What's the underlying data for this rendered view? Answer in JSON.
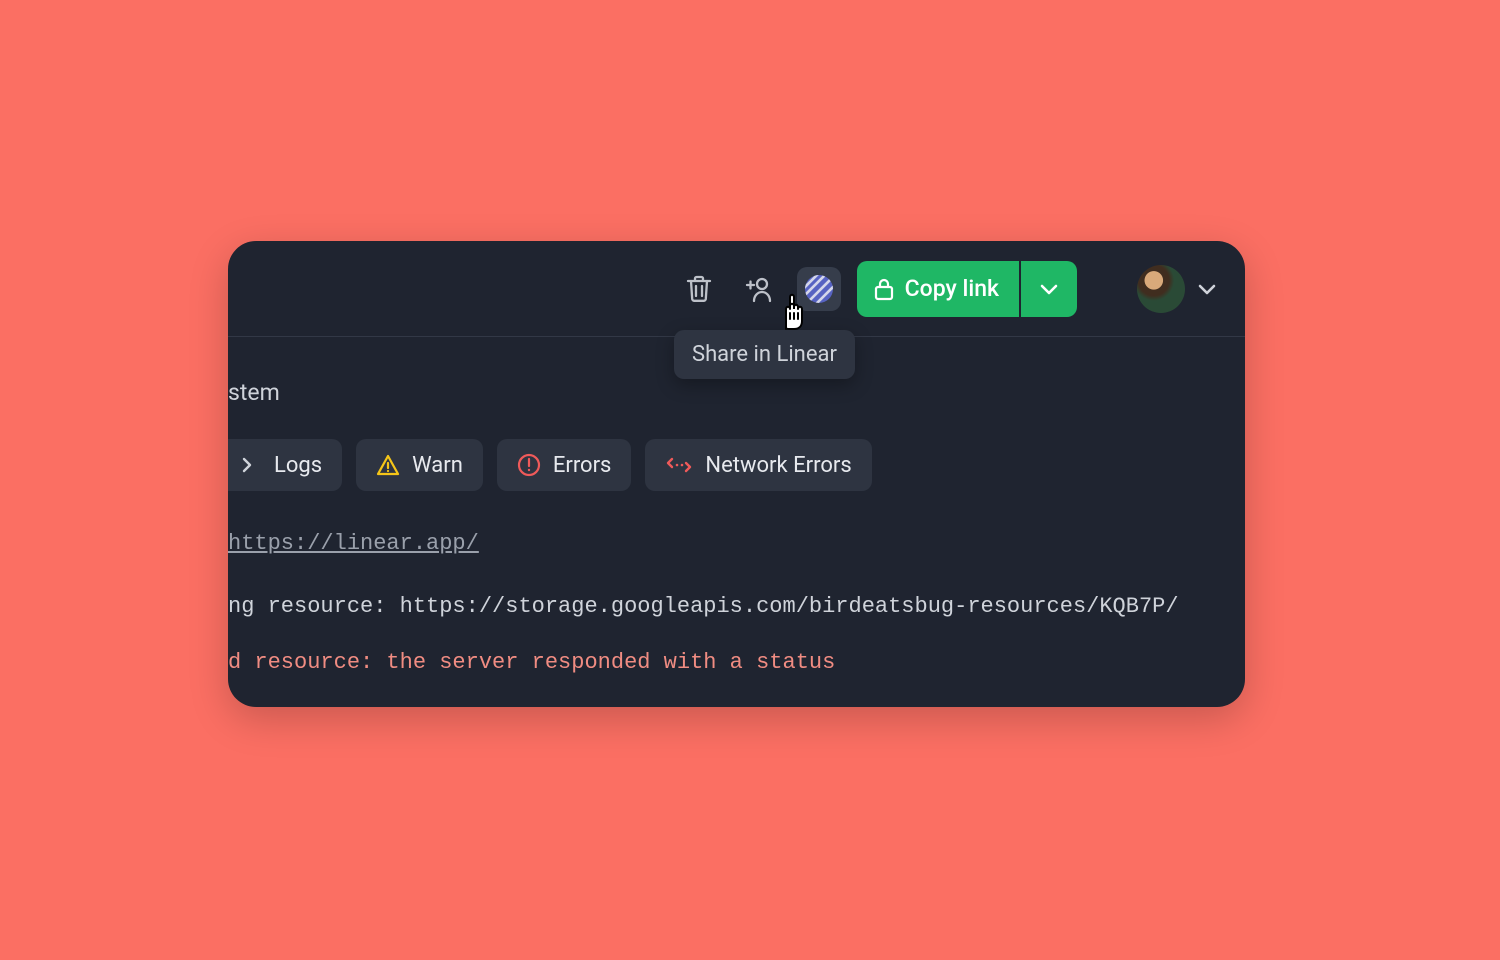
{
  "toolbar": {
    "tooltip": "Share in Linear",
    "copy_label": "Copy link"
  },
  "tabs": {
    "crumb_fragment": "stem",
    "items": [
      {
        "label": "Logs"
      },
      {
        "label": "Warn"
      },
      {
        "label": "Errors"
      },
      {
        "label": "Network Errors"
      }
    ]
  },
  "console": {
    "link": "https://linear.app/",
    "log_line": "ng resource: https://storage.googleapis.com/birdeatsbug-resources/KQB7P/",
    "error_line": "d resource: the server responded with a status"
  },
  "icons": {
    "trash": "trash-icon",
    "add_user": "add-user-icon",
    "linear": "linear-icon",
    "lock": "lock-icon",
    "chevron_down": "chevron-down-icon",
    "logs": "prompt-icon",
    "warn": "warning-icon",
    "error": "error-circle-icon",
    "network": "network-arrows-icon"
  }
}
